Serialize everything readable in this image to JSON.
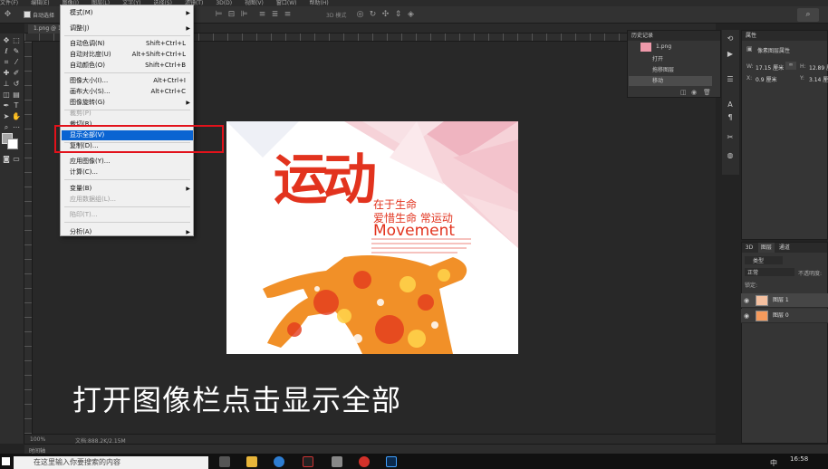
{
  "app": {
    "menubar": [
      "文件(F)",
      "编辑(E)",
      "图像(I)",
      "图层(L)",
      "文字(Y)",
      "选择(S)",
      "滤镜(T)",
      "3D(D)",
      "视图(V)",
      "窗口(W)",
      "帮助(H)"
    ],
    "options": {
      "auto_select": "自动选择",
      "mode_3d": "3D 模式"
    },
    "doc_tab": "1.png @ 100%",
    "zoom": "100%",
    "doc_info": "文档:888.2K/2.15M",
    "timeline": "时间轴"
  },
  "image_menu": {
    "items": [
      {
        "label": "模式(M)",
        "shortcut": "",
        "submenu": true,
        "disabled": false
      },
      {
        "label": "调整(J)",
        "shortcut": "",
        "submenu": true,
        "disabled": false
      },
      {
        "label": "自动色调(N)",
        "shortcut": "Shift+Ctrl+L",
        "submenu": false,
        "disabled": false
      },
      {
        "label": "自动对比度(U)",
        "shortcut": "Alt+Shift+Ctrl+L",
        "submenu": false,
        "disabled": false
      },
      {
        "label": "自动颜色(O)",
        "shortcut": "Shift+Ctrl+B",
        "submenu": false,
        "disabled": false
      },
      {
        "label": "图像大小(I)...",
        "shortcut": "Alt+Ctrl+I",
        "submenu": false,
        "disabled": false
      },
      {
        "label": "画布大小(S)...",
        "shortcut": "Alt+Ctrl+C",
        "submenu": false,
        "disabled": false
      },
      {
        "label": "图像旋转(G)",
        "shortcut": "",
        "submenu": true,
        "disabled": false
      },
      {
        "label": "裁剪(P)",
        "shortcut": "",
        "submenu": false,
        "disabled": true
      },
      {
        "label": "裁切(R)...",
        "shortcut": "",
        "submenu": false,
        "disabled": false
      },
      {
        "label": "显示全部(V)",
        "shortcut": "",
        "submenu": false,
        "disabled": false,
        "highlighted": true
      },
      {
        "label": "复制(D)...",
        "shortcut": "",
        "submenu": false,
        "disabled": false
      },
      {
        "label": "应用图像(Y)...",
        "shortcut": "",
        "submenu": false,
        "disabled": false
      },
      {
        "label": "计算(C)...",
        "shortcut": "",
        "submenu": false,
        "disabled": false
      },
      {
        "label": "变量(B)",
        "shortcut": "",
        "submenu": true,
        "disabled": false
      },
      {
        "label": "应用数据组(L)...",
        "shortcut": "",
        "submenu": false,
        "disabled": true
      },
      {
        "label": "陷印(T)...",
        "shortcut": "",
        "submenu": false,
        "disabled": true
      },
      {
        "label": "分析(A)",
        "shortcut": "",
        "submenu": true,
        "disabled": false
      }
    ]
  },
  "poster": {
    "title_big": "运动",
    "line1": "在于生命",
    "line2": "爱惜生命 常运动",
    "movement": "Movement"
  },
  "caption": "打开图像栏点击显示全部",
  "history": {
    "title": "历史记录",
    "snapshot": "1.png",
    "rows": [
      "打开",
      "拖移图层",
      "移动"
    ]
  },
  "properties": {
    "title": "属性",
    "subtitle": "像素图层属性",
    "w_label": "W:",
    "w_value": "17.15 厘米",
    "h_label": "H:",
    "h_value": "12.89 厘米",
    "x_label": "X:",
    "x_value": "0.9 厘米",
    "y_label": "Y:",
    "y_value": "3.14 厘米"
  },
  "layers": {
    "tabs": [
      "3D",
      "图层",
      "通道"
    ],
    "kind": "类型",
    "blend": "正常",
    "opacity": "不透明度:",
    "lock": "锁定:",
    "rows": [
      "图层 1",
      "图层 0"
    ]
  },
  "taskbar": {
    "search_placeholder": "在这里输入你要搜索的内容",
    "time": "16:58",
    "ime": "中"
  }
}
